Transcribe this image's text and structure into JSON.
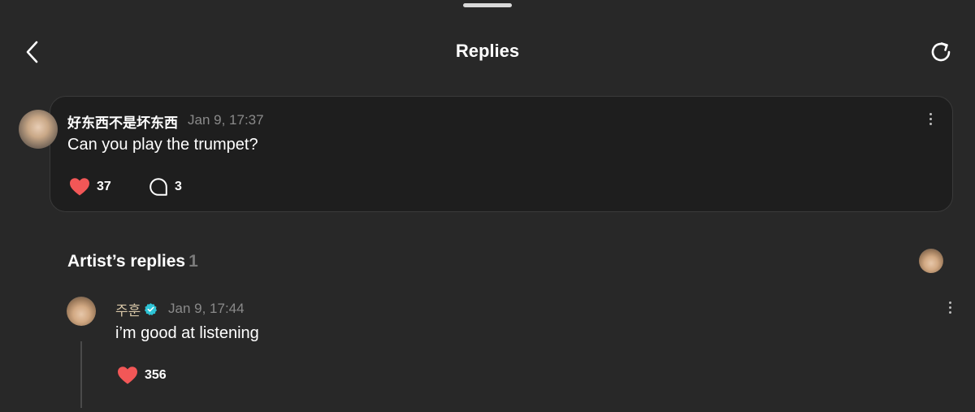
{
  "header": {
    "title": "Replies",
    "back_icon": "chevron-left-icon",
    "refresh_icon": "refresh-icon"
  },
  "comment": {
    "username": "好东西不是坏东西",
    "timestamp": "Jan 9, 17:37",
    "text": "Can you play the trumpet?",
    "likes": "37",
    "replies": "3"
  },
  "artist_replies": {
    "title": "Artist’s replies",
    "count": "1",
    "items": [
      {
        "name": "주훈",
        "verified": true,
        "timestamp": "Jan 9, 17:44",
        "text": "i’m good at listening",
        "likes": "356"
      }
    ]
  },
  "colors": {
    "background": "#282828",
    "card": "#1e1e1e",
    "heart": "#f25757",
    "verified": "#2ec4d6",
    "artist_name": "#d8c7a8",
    "muted": "#8a8a8a"
  }
}
